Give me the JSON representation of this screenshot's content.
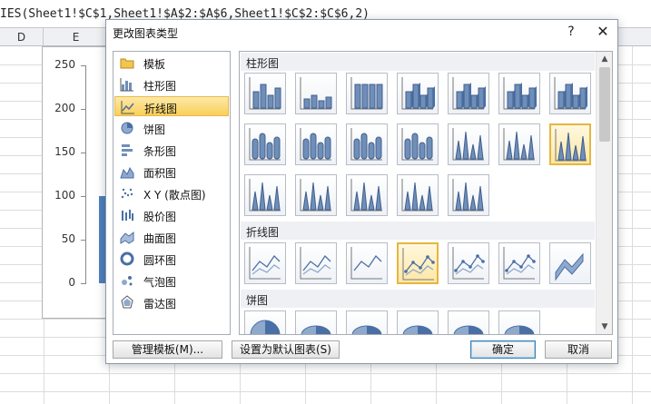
{
  "formula_bar": {
    "text": "IES(Sheet1!$C$1,Sheet1!$A$2:$A$6,Sheet1!$C$2:$C$6,2)"
  },
  "columns": [
    "D",
    "E"
  ],
  "chart": {
    "ticks": [
      "250",
      "200",
      "150",
      "100",
      "50",
      "0"
    ]
  },
  "chart_data": {
    "type": "bar",
    "categories": [
      ""
    ],
    "values": [
      100
    ],
    "ylim": [
      0,
      250
    ],
    "yticks": [
      0,
      50,
      100,
      150,
      200,
      250
    ]
  },
  "dialog": {
    "title": "更改图表类型",
    "help": "?",
    "close": "✕",
    "left_items": [
      {
        "label": "模板",
        "icon": "folder-icon"
      },
      {
        "label": "柱形图",
        "icon": "column-chart-icon"
      },
      {
        "label": "折线图",
        "icon": "line-chart-icon",
        "selected": true
      },
      {
        "label": "饼图",
        "icon": "pie-chart-icon"
      },
      {
        "label": "条形图",
        "icon": "bar-chart-icon"
      },
      {
        "label": "面积图",
        "icon": "area-chart-icon"
      },
      {
        "label": "X Y (散点图)",
        "icon": "scatter-chart-icon"
      },
      {
        "label": "股价图",
        "icon": "stock-chart-icon"
      },
      {
        "label": "曲面图",
        "icon": "surface-chart-icon"
      },
      {
        "label": "圆环图",
        "icon": "doughnut-chart-icon"
      },
      {
        "label": "气泡图",
        "icon": "bubble-chart-icon"
      },
      {
        "label": "雷达图",
        "icon": "radar-chart-icon"
      }
    ],
    "sections": {
      "column": "柱形图",
      "line": "折线图",
      "pie": "饼图"
    },
    "buttons": {
      "manage_templates": "管理模板(M)...",
      "set_default": "设置为默认图表(S)",
      "ok": "确定",
      "cancel": "取消"
    },
    "scroll_up": "▲",
    "scroll_down": "▼"
  }
}
